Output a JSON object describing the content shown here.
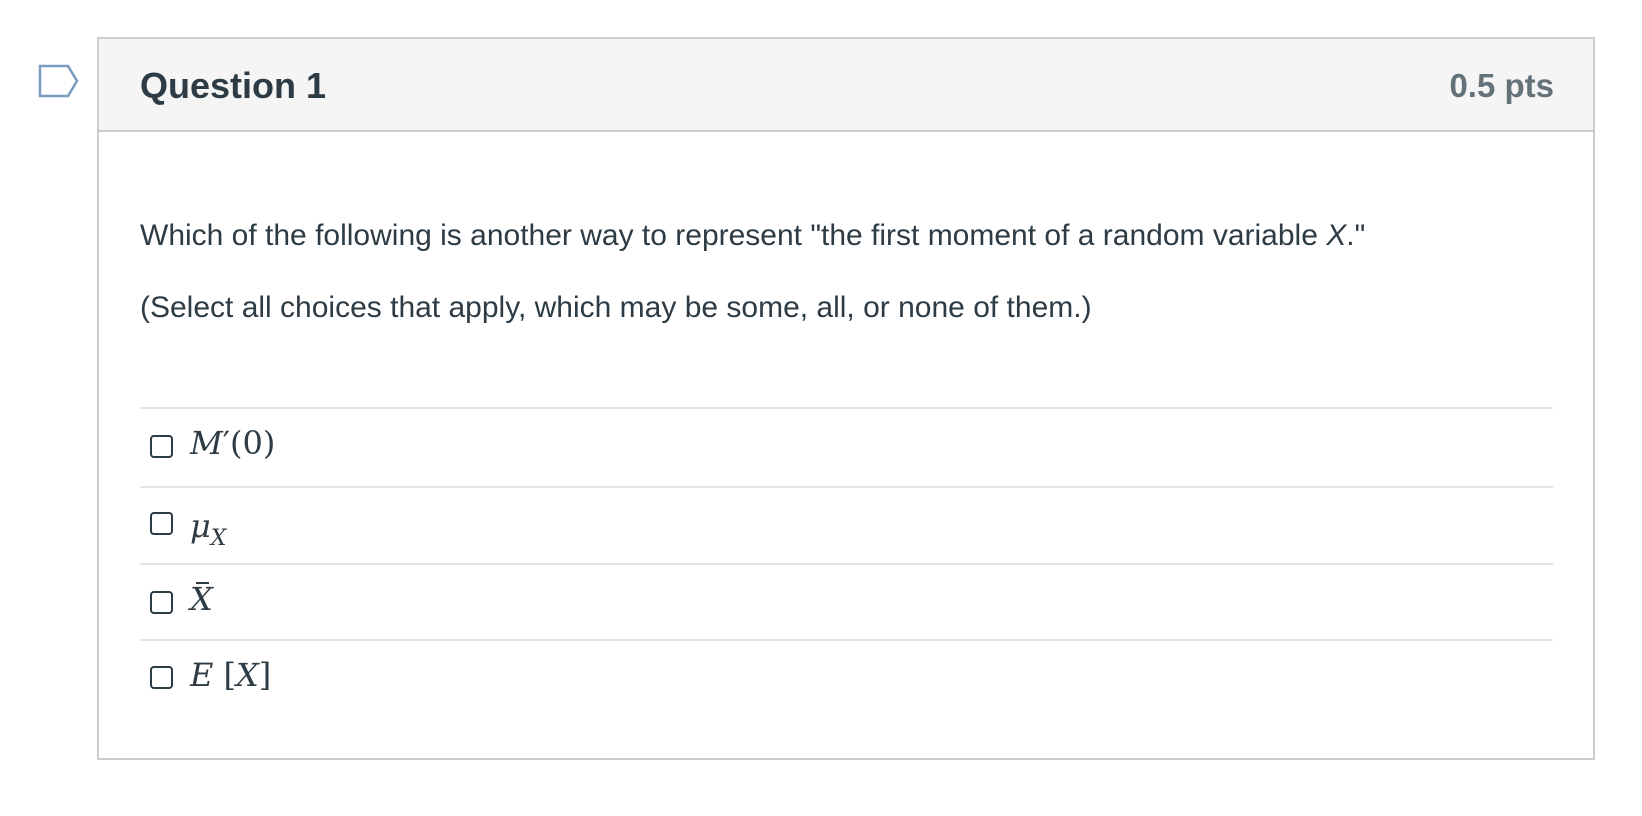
{
  "question": {
    "title": "Question 1",
    "points": "0.5 pts",
    "text_before_var": "Which of the following is another way to represent \"the first moment of a random variable ",
    "variable": "X",
    "text_after_var": ".\"",
    "instruction": "(Select all choices that apply, which may be some, all, or none of them.)"
  },
  "answers": [
    {
      "label": "M′(0)",
      "checked": false
    },
    {
      "label": "μX",
      "checked": false
    },
    {
      "label": "X̄",
      "checked": false
    },
    {
      "label": "E[X]",
      "checked": false
    }
  ],
  "colors": {
    "text": "#2d3b45",
    "points": "#66727a",
    "border": "#c7cdd1",
    "header_bg": "#f5f5f5",
    "divider": "#e1e5e8",
    "flag": "#2b7abc"
  },
  "icons": {
    "flag": "flag-question-icon",
    "checkbox": "checkbox-icon"
  }
}
